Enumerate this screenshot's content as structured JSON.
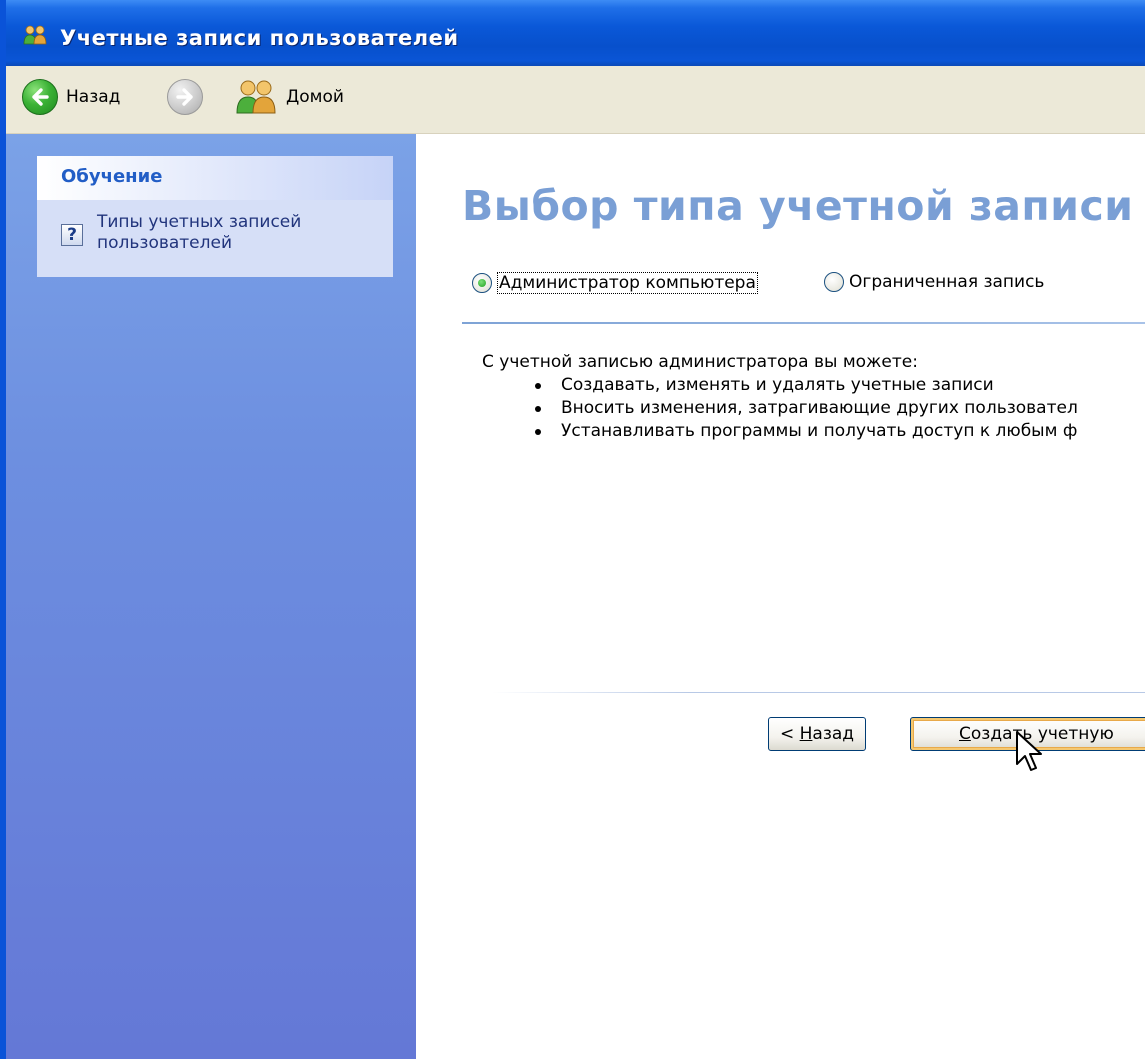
{
  "window": {
    "title": "Учетные записи пользователей"
  },
  "toolbar": {
    "back_label": "Назад",
    "home_label": "Домой"
  },
  "sidebar": {
    "panel_title": "Обучение",
    "link_label": "Типы учетных записей пользователей"
  },
  "main": {
    "title": "Выбор типа учетной записи",
    "options": [
      {
        "label": "Администратор компьютера",
        "selected": true
      },
      {
        "label": "Ограниченная запись",
        "selected": false
      }
    ],
    "description": "С учетной записью администратора вы можете:",
    "bullets": [
      "Создавать, изменять и удалять учетные записи",
      "Вносить изменения, затрагивающие других пользовател",
      "Устанавливать программы и получать доступ к любым ф"
    ],
    "back_button_prefix": "< ",
    "back_button_accel": "Н",
    "back_button_rest": "азад",
    "create_button_accel": "С",
    "create_button_rest": "оздать учетную"
  },
  "colors": {
    "titlebar": "#0a58d8",
    "sidebar": "#6d8fe0",
    "page_title": "#7a9fd5",
    "panel_title": "#215dc6"
  },
  "icons": [
    "users-icon",
    "back-arrow-icon",
    "forward-arrow-icon",
    "home-users-icon",
    "help-icon",
    "mouse-cursor-icon"
  ]
}
